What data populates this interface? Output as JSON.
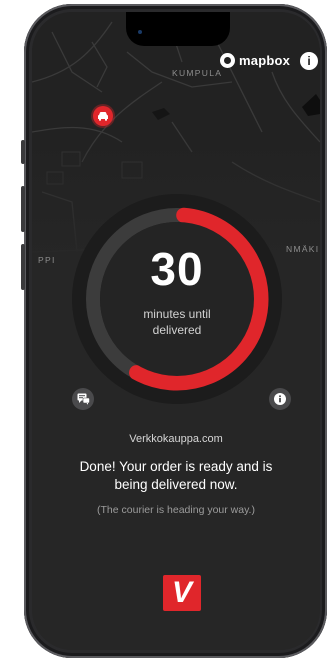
{
  "map": {
    "attribution": "mapbox",
    "labels": [
      "KUMPULA",
      "PPI",
      "NMÄKI"
    ]
  },
  "timer": {
    "value": "30",
    "caption": "minutes until delivered",
    "progress_fraction": 0.58,
    "accent_color": "#e0262b"
  },
  "buttons": {
    "chat_icon": "chat-icon",
    "info_icon": "info-icon"
  },
  "order": {
    "store_name": "Verkkokauppa.com",
    "status": "Done! Your order is ready and is being delivered now.",
    "courier_note": "(The courier is heading your way.)"
  },
  "brand": {
    "logo_letter": "V",
    "color": "#e0262b"
  }
}
